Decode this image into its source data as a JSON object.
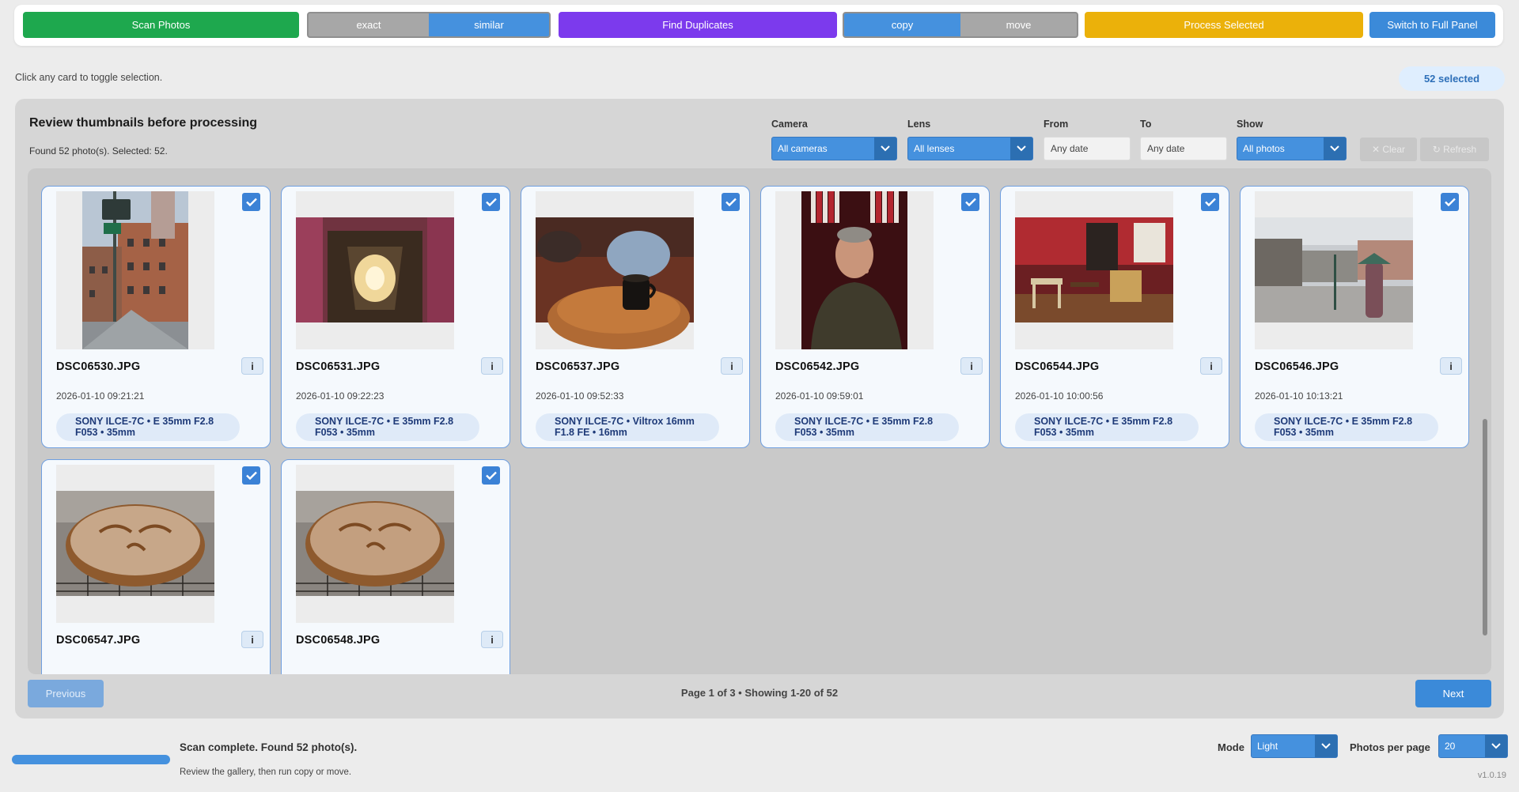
{
  "toolbar": {
    "scan_label": "Scan Photos",
    "match_mode": [
      "exact",
      "similar"
    ],
    "match_mode_selected": "similar",
    "find_label": "Find Duplicates",
    "op_mode": [
      "copy",
      "move"
    ],
    "op_mode_selected": "copy",
    "process_label": "Process Selected",
    "switch_label": "Switch to Full Panel"
  },
  "hint": "Click any card to toggle selection.",
  "selected_badge": "52 selected",
  "review": {
    "title": "Review thumbnails before processing",
    "subtitle": "Found 52 photo(s). Selected: 52.",
    "filters": {
      "camera_label": "Camera",
      "camera_value": "All cameras",
      "lens_label": "Lens",
      "lens_value": "All lenses",
      "from_label": "From",
      "from_placeholder": "Any date",
      "to_label": "To",
      "to_placeholder": "Any date",
      "show_label": "Show",
      "show_value": "All photos",
      "clear_label": "✕ Clear",
      "refresh_label": "↻ Refresh"
    },
    "cards": [
      {
        "name": "DSC06530.JPG",
        "date": "2026-01-10 09:21:21",
        "meta1": "SONY ILCE-7C • E 35mm F2.8",
        "meta2": "F053 • 35mm",
        "selected": true
      },
      {
        "name": "DSC06531.JPG",
        "date": "2026-01-10 09:22:23",
        "meta1": "SONY ILCE-7C • E 35mm F2.8",
        "meta2": "F053 • 35mm",
        "selected": true
      },
      {
        "name": "DSC06537.JPG",
        "date": "2026-01-10 09:52:33",
        "meta1": "SONY ILCE-7C • Viltrox 16mm",
        "meta2": "F1.8 FE • 16mm",
        "selected": true
      },
      {
        "name": "DSC06542.JPG",
        "date": "2026-01-10 09:59:01",
        "meta1": "SONY ILCE-7C • E 35mm F2.8",
        "meta2": "F053 • 35mm",
        "selected": true
      },
      {
        "name": "DSC06544.JPG",
        "date": "2026-01-10 10:00:56",
        "meta1": "SONY ILCE-7C • E 35mm F2.8",
        "meta2": "F053 • 35mm",
        "selected": true
      },
      {
        "name": "DSC06546.JPG",
        "date": "2026-01-10 10:13:21",
        "meta1": "SONY ILCE-7C • E 35mm F2.8",
        "meta2": "F053 • 35mm",
        "selected": true
      },
      {
        "name": "DSC06547.JPG",
        "selected": true
      },
      {
        "name": "DSC06548.JPG",
        "selected": true
      }
    ],
    "info_label": "i",
    "prev_label": "Previous",
    "next_label": "Next",
    "page_info": "Page 1 of 3 • Showing 1-20 of 52"
  },
  "status": {
    "main": "Scan complete. Found 52 photo(s).",
    "sub": "Review the gallery, then run copy or move.",
    "progress": 1.0,
    "mode_label": "Mode",
    "mode_value": "Light",
    "per_page_label": "Photos per page",
    "per_page_value": "20",
    "version": "v1.0.19"
  },
  "colors": {
    "scan": "#1ea84e",
    "find": "#7c3aed",
    "process": "#ebb10a",
    "switch": "#3b8ad9",
    "accent": "#4591de"
  }
}
